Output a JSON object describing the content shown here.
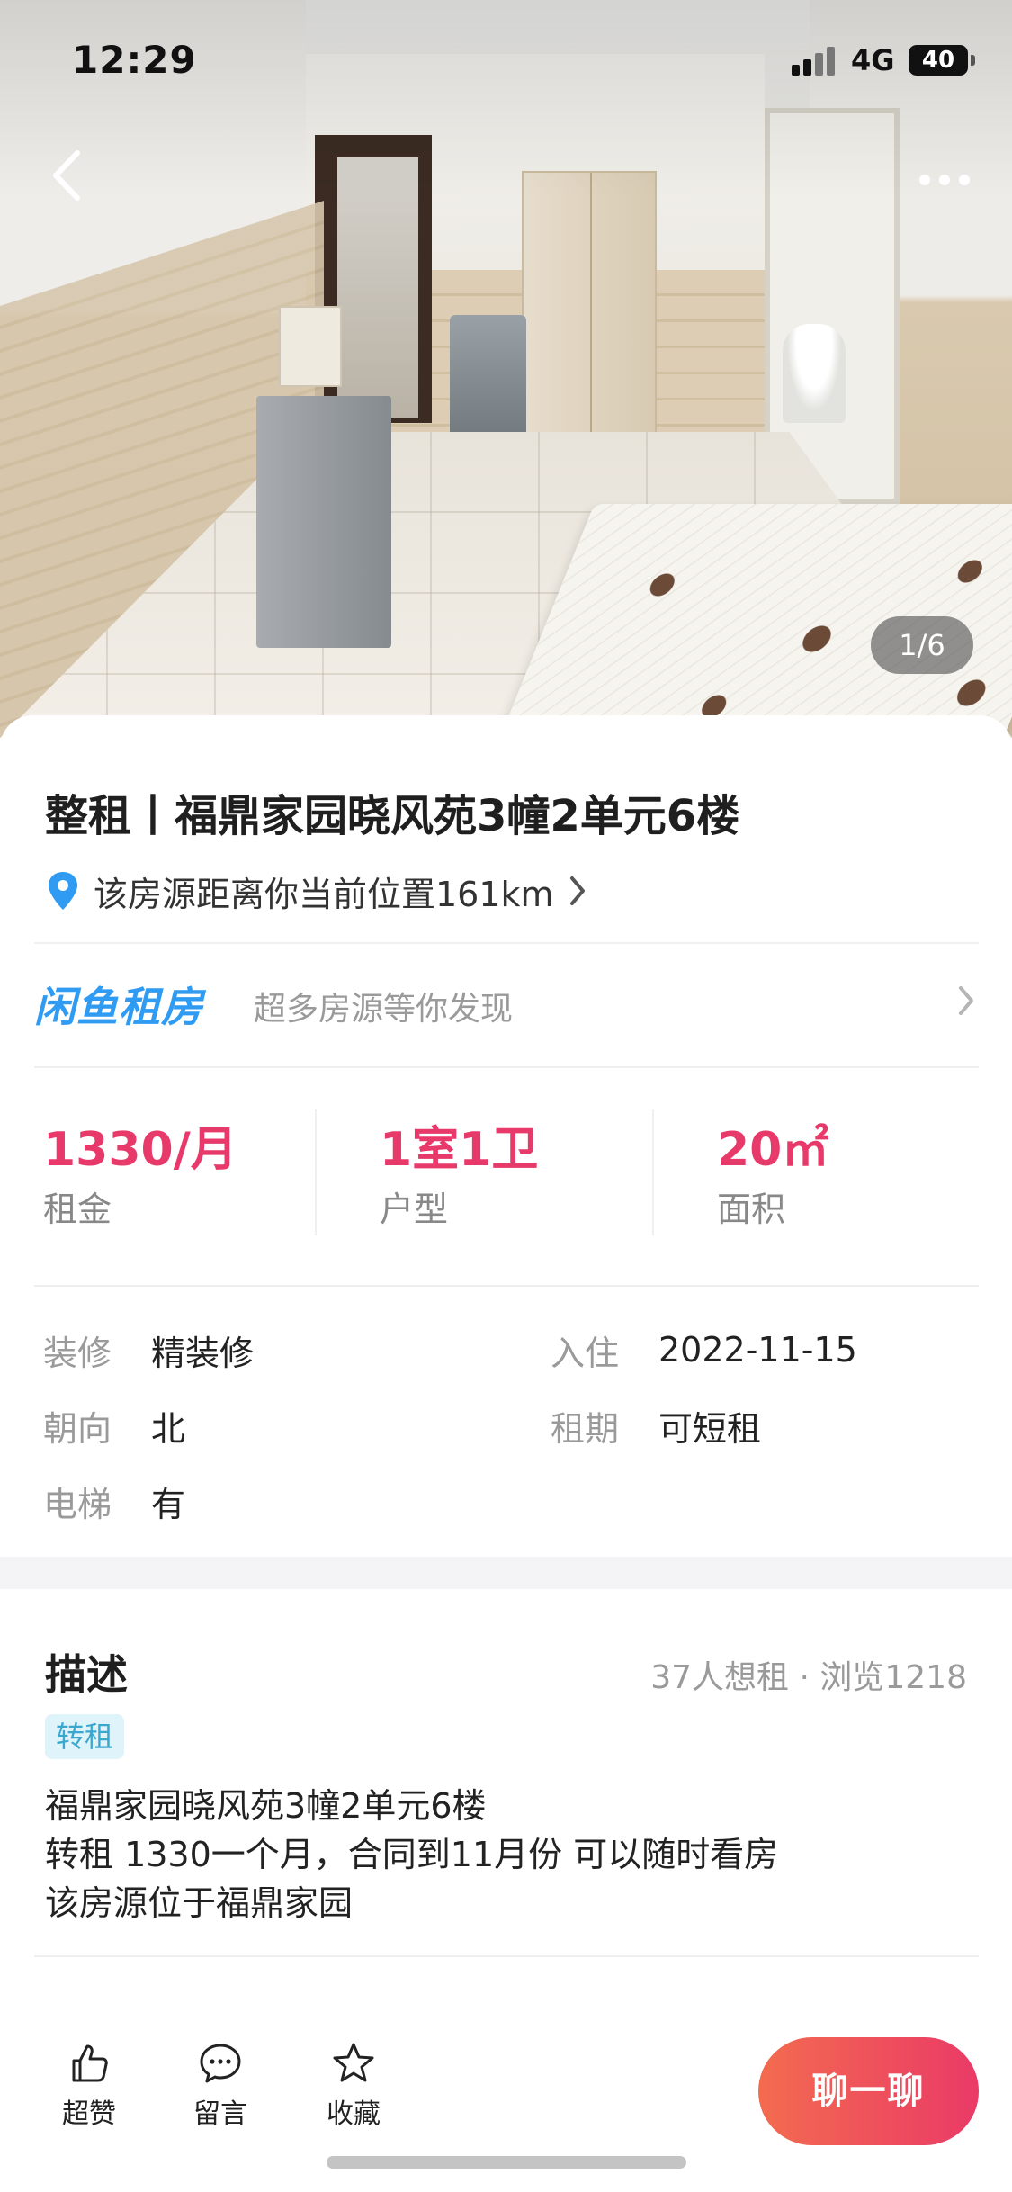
{
  "status_bar": {
    "time": "12:29",
    "network": "4G",
    "battery": "40"
  },
  "photo": {
    "counter": "1/6"
  },
  "listing": {
    "title": "整租丨福鼎家园晓风苑3幢2单元6楼",
    "location": "该房源距离你当前位置161km"
  },
  "promo": {
    "logo": "闲鱼租房",
    "text": "超多房源等你发现"
  },
  "stats": [
    {
      "value": "1330/月",
      "label": "租金"
    },
    {
      "value": "1室1卫",
      "label": "户型"
    },
    {
      "value": "20㎡",
      "label": "面积"
    }
  ],
  "details": {
    "decoration": {
      "key": "装修",
      "value": "精装修"
    },
    "move_in": {
      "key": "入住",
      "value": "2022-11-15"
    },
    "orientation": {
      "key": "朝向",
      "value": "北"
    },
    "lease": {
      "key": "租期",
      "value": "可短租"
    },
    "elevator": {
      "key": "电梯",
      "value": "有"
    }
  },
  "description": {
    "title": "描述",
    "stats": "37人想租 · 浏览1218",
    "tag": "转租",
    "lines": [
      "福鼎家园晓风苑3幢2单元6楼",
      "转租 1330一个月，合同到11月份 可以随时看房",
      "该房源位于福鼎家园"
    ]
  },
  "actions": {
    "like": "超赞",
    "comment": "留言",
    "favorite": "收藏",
    "chat": "聊一聊"
  },
  "colors": {
    "accent_price": "#e8396b",
    "brand_blue": "#2f9bf2",
    "chat_start": "#f36b4f",
    "chat_end": "#ea3a67"
  }
}
